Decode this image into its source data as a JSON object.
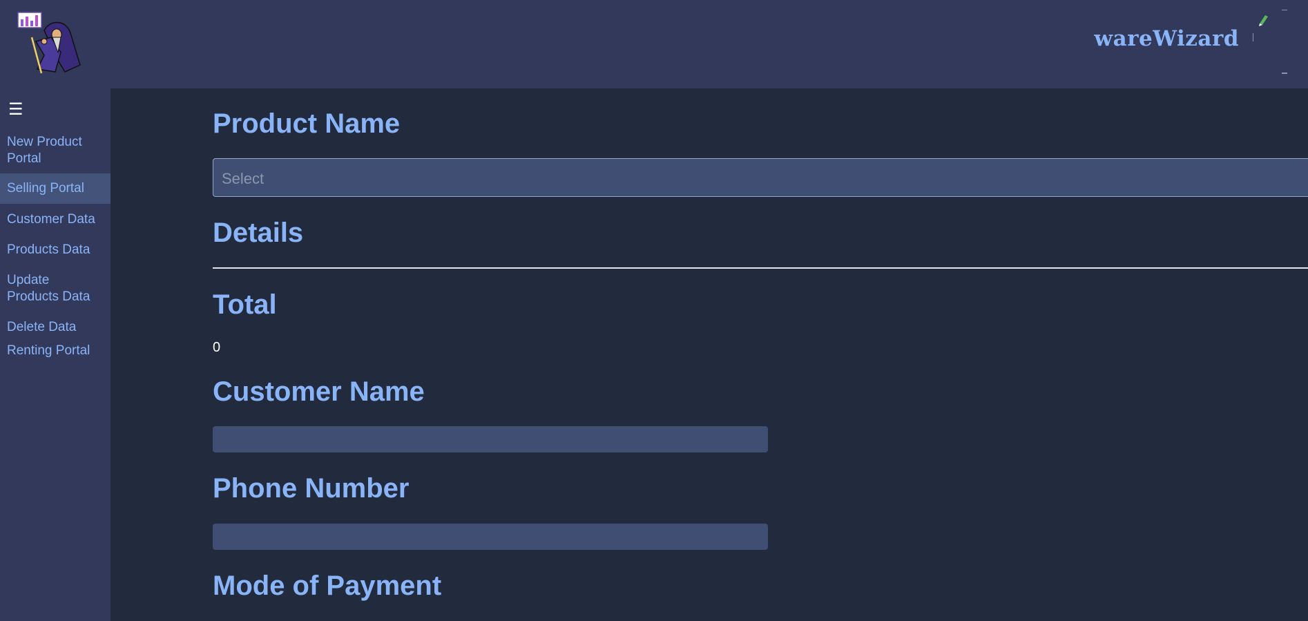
{
  "header": {
    "brand": "wareWizard"
  },
  "sidebar": {
    "toggle_icon": "hamburger-menu-icon",
    "items": [
      {
        "label": "New Product Portal"
      },
      {
        "label": "Selling Portal",
        "active": true
      },
      {
        "label": "Customer Data"
      },
      {
        "label": "Products Data"
      },
      {
        "label": "Update Products Data"
      },
      {
        "label": "Delete Data"
      },
      {
        "label": "Renting Portal"
      }
    ]
  },
  "form": {
    "product_name_label": "Product Name",
    "product_select_placeholder": "Select",
    "details_label": "Details",
    "total_label": "Total",
    "total_value": "0",
    "customer_name_label": "Customer Name",
    "customer_name_value": "",
    "phone_number_label": "Phone Number",
    "phone_number_value": "",
    "mode_of_payment_label": "Mode of Payment"
  },
  "colors": {
    "header_bg": "#32395a",
    "page_bg": "#222a3d",
    "accent": "#8ab4f8",
    "active_nav": "#44537a",
    "field_bg": "#404e73"
  }
}
